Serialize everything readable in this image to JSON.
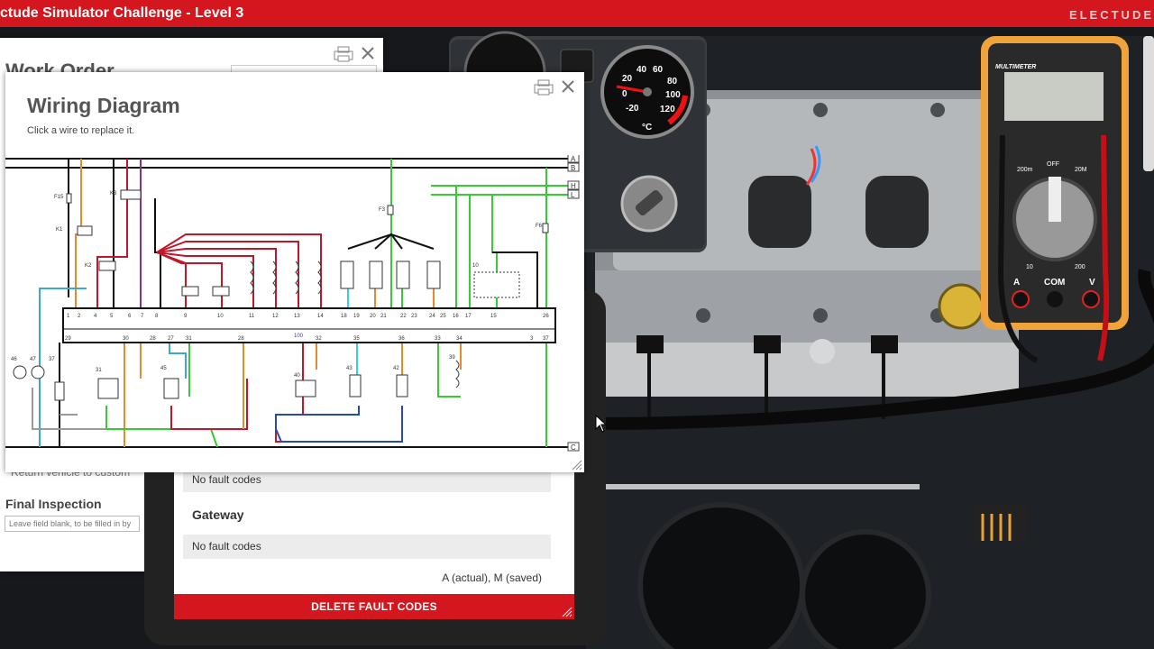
{
  "app": {
    "title": "ctude Simulator Challenge - Level 3",
    "brand": "ELECTUDE"
  },
  "gauge": {
    "ticks": [
      "-20",
      "0",
      "20",
      "40",
      "60",
      "80",
      "100",
      "120"
    ],
    "unit": "°C"
  },
  "multimeter": {
    "title": "MULTIMETER",
    "dial_labels": [
      "200m",
      "OFF",
      "20M",
      "10",
      "200"
    ],
    "jacks": [
      "A",
      "COM",
      "V"
    ]
  },
  "work_order": {
    "title": "Work Order",
    "return_text": "Return vehicle to custom",
    "final_label": "Final Inspection",
    "final_placeholder": "Leave field blank, to be filled in by"
  },
  "tablet": {
    "row1": "No fault codes",
    "gateway_title": "Gateway",
    "row2": "No fault codes",
    "legend": "A (actual), M (saved)",
    "delete_label": "DELETE FAULT CODES"
  },
  "wiring": {
    "title": "Wiring Diagram",
    "subtitle": "Click a wire to replace it.",
    "rail_labels": [
      "A",
      "B",
      "H",
      "L",
      "C"
    ],
    "connector_top": [
      "1",
      "2",
      "4",
      "5",
      "6",
      "7",
      "8",
      "9",
      "10",
      "11",
      "12",
      "13",
      "14",
      "18",
      "19",
      "20",
      "21",
      "22",
      "23",
      "24",
      "25",
      "16",
      "17",
      "15",
      "26"
    ],
    "connector_bottom": [
      "29",
      "30",
      "28",
      "27",
      "31",
      "28",
      "32",
      "35",
      "36",
      "33",
      "34",
      "3",
      "37"
    ],
    "connector_center": "100",
    "components": [
      "F15",
      "K1",
      "K2",
      "K3",
      "F3",
      "F6",
      "46",
      "47",
      "37",
      "31",
      "45",
      "40",
      "43",
      "42",
      "39",
      "10"
    ]
  },
  "colors": {
    "accent": "#d4171e",
    "panel": "#ffffff",
    "dark": "#15171a"
  }
}
